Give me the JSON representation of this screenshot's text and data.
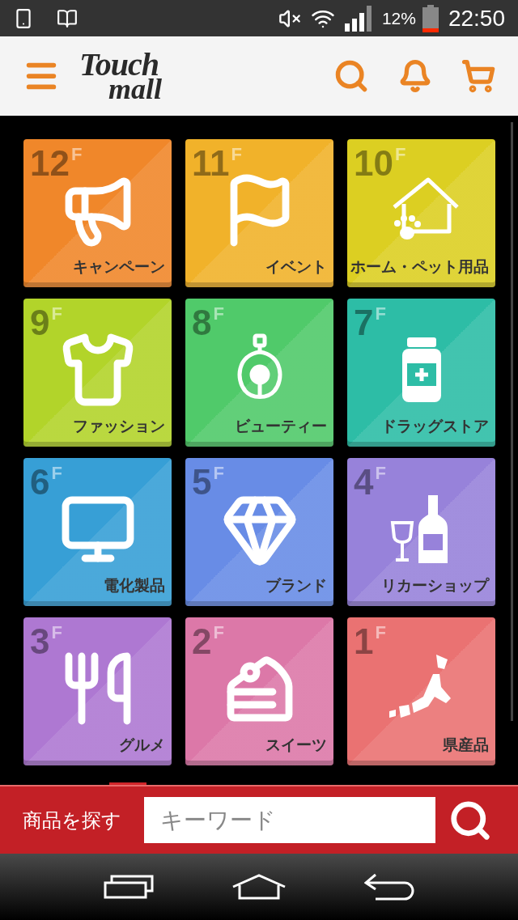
{
  "status_bar": {
    "battery": "12%",
    "time": "22:50"
  },
  "header": {
    "logo": {
      "line_1": "Touch",
      "line_2": "mall"
    }
  },
  "floors": [
    {
      "floor": "12",
      "unit": "F",
      "label": "キャンペーン",
      "color": "#f0872a",
      "kind": "megaphone"
    },
    {
      "floor": "11",
      "unit": "F",
      "label": "イベント",
      "color": "#f1b22a",
      "kind": "flag"
    },
    {
      "floor": "10",
      "unit": "F",
      "label": "ホーム・ペット用品",
      "color": "#dccf22",
      "kind": "pet-house"
    },
    {
      "floor": "9",
      "unit": "F",
      "label": "ファッション",
      "color": "#b2d42a",
      "kind": "shirt"
    },
    {
      "floor": "8",
      "unit": "F",
      "label": "ビューティー",
      "color": "#50ca6a",
      "kind": "perfume"
    },
    {
      "floor": "7",
      "unit": "F",
      "label": "ドラッグストア",
      "color": "#2dbda6",
      "kind": "medicine"
    },
    {
      "floor": "6",
      "unit": "F",
      "label": "電化製品",
      "color": "#379fd6",
      "kind": "monitor"
    },
    {
      "floor": "5",
      "unit": "F",
      "label": "ブランド",
      "color": "#688ce6",
      "kind": "gem"
    },
    {
      "floor": "4",
      "unit": "F",
      "label": "リカーショップ",
      "color": "#9782da",
      "kind": "liquor"
    },
    {
      "floor": "3",
      "unit": "F",
      "label": "グルメ",
      "color": "#ae78d2",
      "kind": "utensils"
    },
    {
      "floor": "2",
      "unit": "F",
      "label": "スイーツ",
      "color": "#dc78a8",
      "kind": "cake"
    },
    {
      "floor": "1",
      "unit": "F",
      "label": "県産品",
      "color": "#ea7272",
      "kind": "japan"
    }
  ],
  "search": {
    "label": "商品を探す",
    "placeholder": "キーワード"
  }
}
